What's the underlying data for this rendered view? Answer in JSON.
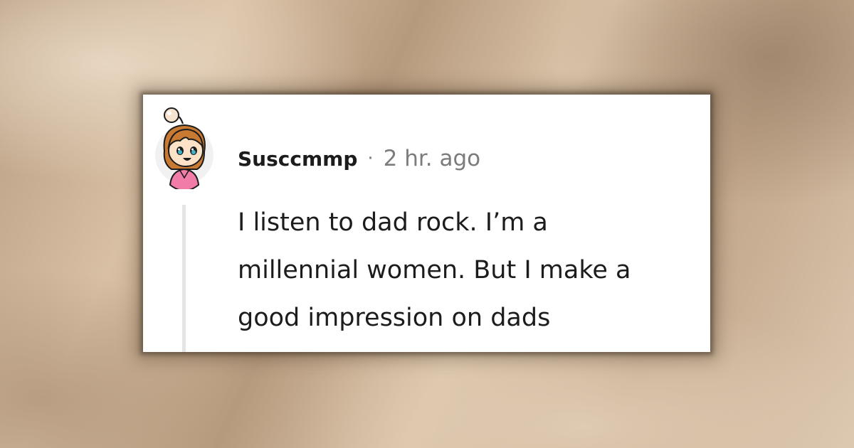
{
  "comment": {
    "author": "Susccmmp",
    "separator": "·",
    "timestamp": "2 hr. ago",
    "avatar_icon": "cartoon-girl-avatar-icon",
    "body_lines": [
      "I listen to dad rock. I’m a",
      "millennial women. But I make a",
      "good impression on dads"
    ]
  },
  "colors": {
    "card_background": "#ffffff",
    "text_primary": "#1c1c1c",
    "text_secondary": "#7c7c7c",
    "thread_line": "#e5e5e5",
    "backdrop": "#c9b198",
    "avatar_hair": "#c87a32",
    "avatar_shirt": "#f27ca8"
  }
}
